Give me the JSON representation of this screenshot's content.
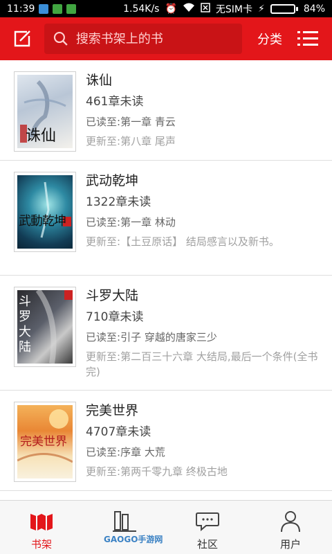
{
  "status_bar": {
    "time": "11:39",
    "speed": "1.54K/s",
    "sim": "无SIM卡",
    "battery_percent": "84%",
    "battery_level": 0.84
  },
  "header": {
    "search_placeholder": "搜索书架上的书",
    "category_label": "分类"
  },
  "books": [
    {
      "title": "诛仙",
      "unread": "461章未读",
      "read_label": "已读至:",
      "read_chapter": "第一章 青云",
      "update_label": "更新至:",
      "update_chapter": "第八章 尾声",
      "cover_text": "诛仙"
    },
    {
      "title": "武动乾坤",
      "unread": "1322章未读",
      "read_label": "已读至:",
      "read_chapter": "第一章 林动",
      "update_label": "更新至:",
      "update_chapter": "【土豆原话】 结局感言以及新书。",
      "cover_text": "武動乾坤"
    },
    {
      "title": "斗罗大陆",
      "unread": "710章未读",
      "read_label": "已读至:",
      "read_chapter": "引子 穿越的唐家三少",
      "update_label": "更新至:",
      "update_chapter": "第二百三十六章 大结局,最后一个条件(全书完)",
      "cover_text": "斗罗大陆"
    },
    {
      "title": "完美世界",
      "unread": "4707章未读",
      "read_label": "已读至:",
      "read_chapter": "序章 大荒",
      "update_label": "更新至:",
      "update_chapter": "第两千零九章 终极古地",
      "cover_text": "完美世界"
    }
  ],
  "bottom_nav": [
    {
      "label": "书架",
      "active": true
    },
    {
      "label": "",
      "active": false
    },
    {
      "label": "社区",
      "active": false
    },
    {
      "label": "用户",
      "active": false
    }
  ],
  "watermark": "GAOGO手游网",
  "colors": {
    "brand_red": "#e3161a",
    "search_bg": "#c91316"
  }
}
